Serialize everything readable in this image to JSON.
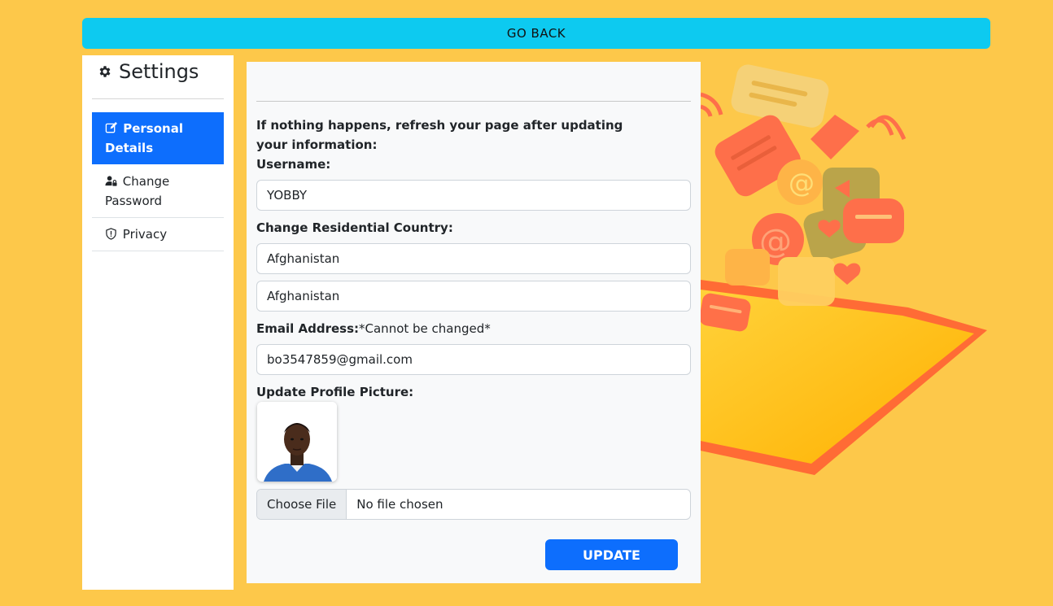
{
  "header": {
    "go_back_label": "GO BACK"
  },
  "sidebar": {
    "title": "Settings",
    "items": [
      {
        "label": "Personal Details",
        "icon": "edit-icon",
        "active": true
      },
      {
        "label": "Change Password",
        "icon": "user-lock-icon",
        "active": false
      },
      {
        "label": "Privacy",
        "icon": "shield-icon",
        "active": false
      }
    ]
  },
  "form": {
    "notice": "If nothing happens, refresh your page after updating your information:",
    "username_label": "Username:",
    "username_value": "YOBBY",
    "country_label": "Change Residential Country:",
    "country_value": "Afghanistan",
    "country_select_value": "Afghanistan",
    "email_label": "Email Address:",
    "email_note": "*Cannot be changed*",
    "email_value": "bo3547859@gmail.com",
    "picture_label": "Update Profile Picture:",
    "file_button": "Choose File",
    "file_status": "No file chosen",
    "update_label": "UPDATE"
  },
  "colors": {
    "background": "#fdc84a",
    "go_back": "#0dcaf0",
    "primary": "#0d6efd"
  }
}
